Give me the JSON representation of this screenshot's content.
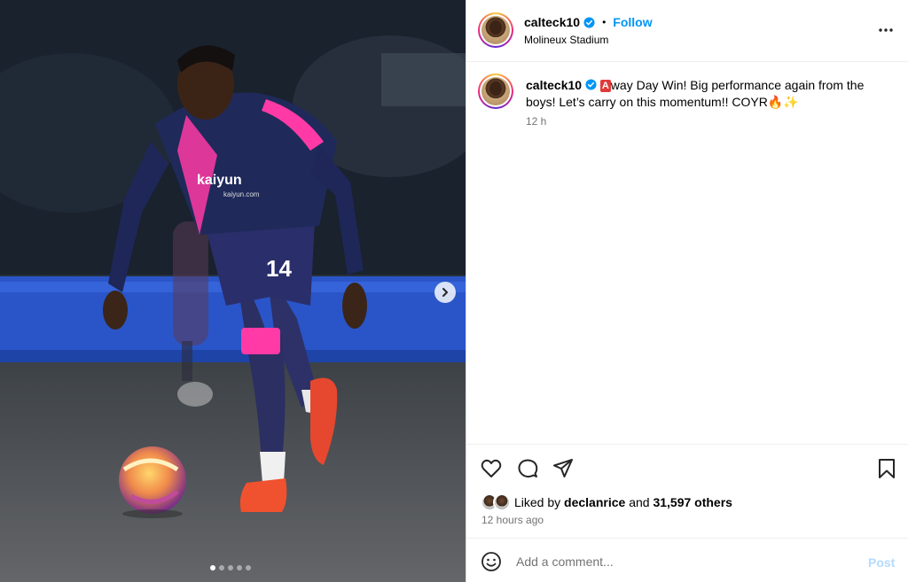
{
  "post": {
    "username": "calteck10",
    "verified": true,
    "follow_label": "Follow",
    "location": "Molineux Stadium",
    "caption_emoji_badge": "A",
    "caption_text": "way Day Win! Big performance again from the boys! Let’s carry on this momentum!! COYR🔥✨",
    "caption_time": "12 h",
    "jersey_number": "14",
    "sponsor_text": "kaiyun",
    "sponsor_sub": "kaiyun.com"
  },
  "carousel": {
    "total_slides": 5,
    "active_slide": 1
  },
  "actions": {
    "icons": [
      "heart-icon",
      "comment-icon",
      "share-icon",
      "bookmark-icon"
    ]
  },
  "likes": {
    "liked_by_prefix": "Liked by",
    "liked_by_user": "declanrice",
    "and_label": "and",
    "others_count": "31,597 others",
    "time_ago": "12 hours ago"
  },
  "comment_box": {
    "placeholder": "Add a comment...",
    "post_label": "Post"
  },
  "colors": {
    "accent_blue": "#0095f6",
    "post_disabled": "#b3dbff",
    "muted_text": "#737373",
    "kit_navy": "#1f2a5a",
    "kit_pink": "#ff3aa6"
  }
}
